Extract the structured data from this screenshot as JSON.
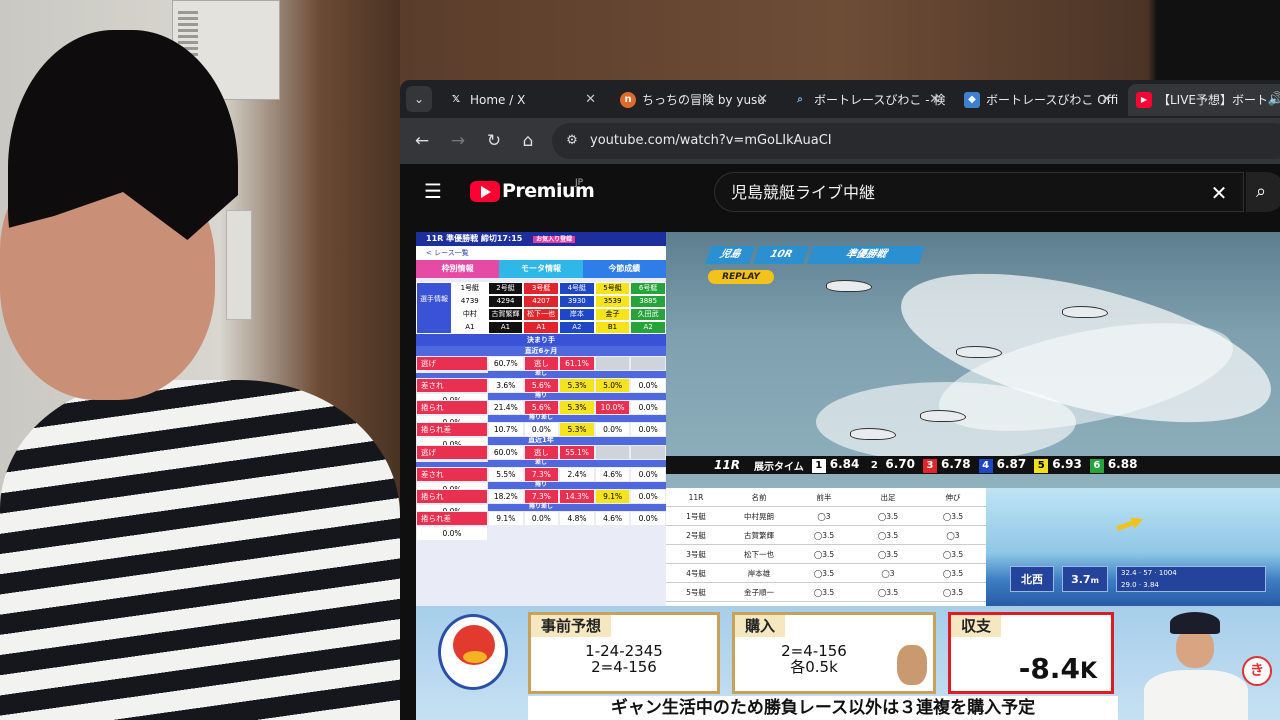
{
  "tabs": [
    {
      "title": "Home / X",
      "favicon": "x-logo-icon"
    },
    {
      "title": "ちっちの冒険 by yusu",
      "favicon": "note-icon"
    },
    {
      "title": "ボートレースびわこ - 検",
      "favicon": "search-icon"
    },
    {
      "title": "ボートレースびわこ Offi",
      "favicon": "boat-site-icon"
    },
    {
      "title": "【LIVE予想】ボート",
      "favicon": "youtube-icon",
      "active": true
    }
  ],
  "address_bar": {
    "url": "youtube.com/watch?v=mGoLIkAuaCI"
  },
  "youtube": {
    "logo_text": "Premium",
    "region": "JP",
    "search_query": "児島競艇ライブ中継"
  },
  "stats_panel": {
    "header": "11R 準優勝戦  締切17:15",
    "fav_badge": "お気入り登録",
    "sub": "< レース一覧",
    "tabs": [
      "枠別情報",
      "モータ情報",
      "今節成績"
    ],
    "boats_header": [
      "1号艇",
      "2号艇",
      "3号艇",
      "4号艇",
      "5号艇",
      "6号艇"
    ],
    "row_label": "選手情報",
    "racer_ids": [
      "4739",
      "4294",
      "4207",
      "3930",
      "3539",
      "3885"
    ],
    "racer_names": [
      "中村",
      "古賀繁輝",
      "松下一也",
      "岸本",
      "金子",
      "久田武"
    ],
    "racer_class": [
      "A1",
      "A1",
      "A1",
      "A2",
      "B1",
      "A2"
    ],
    "section_kimarite": "決まり手",
    "period_6m": "直近6ヶ月",
    "period_1y": "直近1年",
    "rows_6m": [
      {
        "label": "逃げ",
        "values": [
          "60.7%",
          "逃し",
          "61.1%",
          "",
          "",
          ""
        ],
        "sub": ""
      },
      {
        "label": "差され",
        "values": [
          "3.6%",
          "5.6%",
          "5.3%",
          "5.0%",
          "0.0%",
          "0.0%"
        ],
        "sub": "差し"
      },
      {
        "label": "捲られ",
        "values": [
          "21.4%",
          "5.6%",
          "5.3%",
          "10.0%",
          "0.0%",
          "0.0%"
        ],
        "sub": "捲り"
      },
      {
        "label": "捲られ差",
        "values": [
          "10.7%",
          "0.0%",
          "5.3%",
          "0.0%",
          "0.0%",
          "0.0%"
        ],
        "sub": "捲り差し"
      }
    ],
    "rows_1y": [
      {
        "label": "逃げ",
        "values": [
          "60.0%",
          "逃し",
          "55.1%",
          "",
          "",
          ""
        ],
        "sub": ""
      },
      {
        "label": "差され",
        "values": [
          "5.5%",
          "7.3%",
          "2.4%",
          "4.6%",
          "0.0%",
          "0.0%"
        ],
        "sub": "差し"
      },
      {
        "label": "捲られ",
        "values": [
          "18.2%",
          "7.3%",
          "14.3%",
          "9.1%",
          "0.0%",
          "0.0%"
        ],
        "sub": "捲り"
      },
      {
        "label": "捲られ差",
        "values": [
          "9.1%",
          "0.0%",
          "4.8%",
          "4.6%",
          "0.0%",
          "0.0%"
        ],
        "sub": "捲り差し"
      }
    ]
  },
  "race_overlay": {
    "venue": "児島",
    "race": "10R",
    "race_type": "準優勝戦",
    "replay": "REPLAY",
    "exhibit_label": "11R",
    "exhibit_title": "展示タイム",
    "times": [
      {
        "num": "1",
        "time": "6.84",
        "color": "#ffffff",
        "text": "#000000"
      },
      {
        "num": "2",
        "time": "6.70",
        "color": "#111111",
        "text": "#ffffff"
      },
      {
        "num": "3",
        "time": "6.78",
        "color": "#e0262c",
        "text": "#ffffff"
      },
      {
        "num": "4",
        "time": "6.87",
        "color": "#1e47c8",
        "text": "#ffffff"
      },
      {
        "num": "5",
        "time": "6.93",
        "color": "#f3e01c",
        "text": "#000000"
      },
      {
        "num": "6",
        "time": "6.88",
        "color": "#26a33a",
        "text": "#ffffff"
      }
    ]
  },
  "entry_table": {
    "headers": [
      "11R",
      "名前",
      "前半",
      "出足",
      "伸び"
    ],
    "rows": [
      [
        "1号艇",
        "中村晃朗",
        "◯3",
        "◯3.5",
        "◯3.5"
      ],
      [
        "2号艇",
        "古賀繁輝",
        "◯3.5",
        "◯3.5",
        "◯3"
      ],
      [
        "3号艇",
        "松下一也",
        "◯3.5",
        "◯3.5",
        "◯3.5"
      ],
      [
        "4号艇",
        "岸本雄",
        "◯3.5",
        "◯3",
        "◯3.5"
      ],
      [
        "5号艇",
        "金子順一",
        "◯3.5",
        "◯3.5",
        "◯3.5"
      ],
      [
        "6号艇",
        "久田武",
        "◯3.5",
        "◯3.5",
        "◯3.5"
      ]
    ]
  },
  "course_info": {
    "wind_label": "風向",
    "wind_dir": "北西",
    "wind_speed": "3.7",
    "wind_unit": "m",
    "temp": "32.4",
    "water": "29.0",
    "wave": "57",
    "pressure": "1004",
    "water_height": "3.84"
  },
  "bottom": {
    "mascot_text": "KOJIMA BOAT",
    "pred_title": "事前予想",
    "pred_lines": [
      "1-24-2345",
      "2=4-156"
    ],
    "buy_title": "購入",
    "buy_lines": [
      "2=4-156",
      "各0.5k"
    ],
    "balance_title": "収支",
    "balance_value": "-8.4",
    "balance_unit": "K",
    "caption": "ギャン生活中のため勝負レース以外は３連複を購入予定",
    "seal": "き"
  }
}
